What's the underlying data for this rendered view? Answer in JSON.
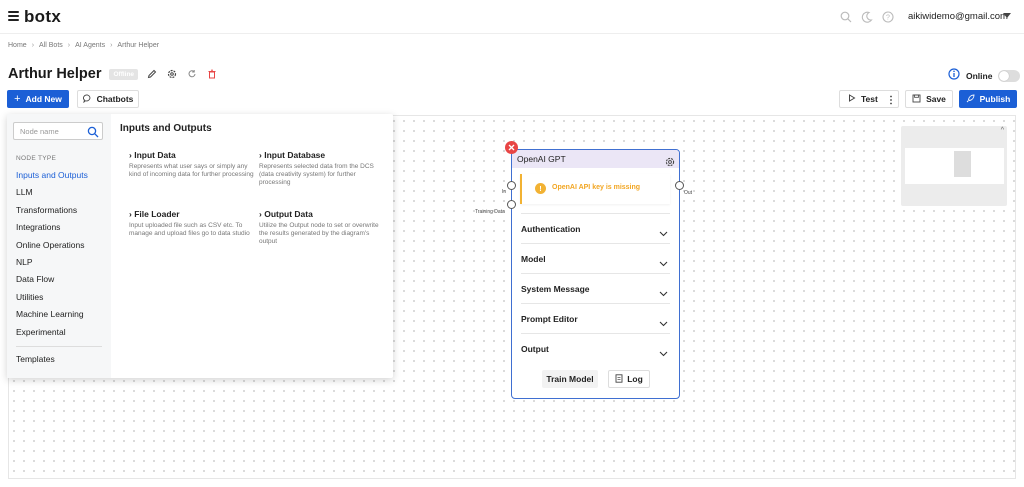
{
  "app": {
    "brand": "botx",
    "user_email": "aikiwidemo@gmail.com",
    "icons": [
      "search-icon",
      "moon-icon",
      "help-icon"
    ]
  },
  "breadcrumb": [
    "Home",
    "All Bots",
    "AI Agents",
    "Arthur Helper"
  ],
  "page": {
    "title": "Arthur Helper",
    "status_badge": "Offline",
    "online_label": "Online",
    "online": false
  },
  "toolbar": {
    "add_new": "Add New",
    "chatbots": "Chatbots",
    "test": "Test",
    "save": "Save",
    "publish": "Publish"
  },
  "node_panel": {
    "search_placeholder": "Node name",
    "node_type_label": "NODE TYPE",
    "categories": [
      "Inputs and Outputs",
      "LLM",
      "Transformations",
      "Integrations",
      "Online Operations",
      "NLP",
      "Data Flow",
      "Utilities",
      "Machine Learning",
      "Experimental"
    ],
    "active_category": "Inputs and Outputs",
    "templates": "Templates",
    "section_title": "Inputs and Outputs",
    "nodes": [
      {
        "title": "Input Data",
        "desc": "Represents what user says or simply any kind of incoming data for further processing"
      },
      {
        "title": "Input Database",
        "desc": "Represents selected data from the DCS (data creativity system) for further processing"
      },
      {
        "title": "File Loader",
        "desc": "Input uploaded file such as CSV etc. To manage and upload files go to data studio"
      },
      {
        "title": "Output Data",
        "desc": "Utilize the Output node to set or overwrite the results generated by the diagram's output"
      }
    ]
  },
  "gpt_node": {
    "title": "OpenAI GPT",
    "warning": "OpenAI API key is missing",
    "sections": [
      "Authentication",
      "Model",
      "System Message",
      "Prompt Editor",
      "Output"
    ],
    "train_button": "Train Model",
    "log_button": "Log",
    "ports": {
      "in": "In",
      "training": "Training Data",
      "out": "Out"
    }
  },
  "colors": {
    "primary": "#1b5fd6",
    "warning": "#f2b233",
    "danger": "#e84545",
    "node_border": "#3f6fd1",
    "node_header": "#ebe6f6"
  }
}
